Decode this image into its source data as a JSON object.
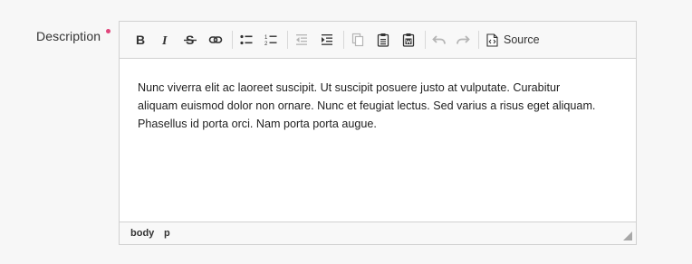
{
  "field": {
    "label": "Description"
  },
  "colors": {
    "required_mark": "#e0457b",
    "icon_active": "#333333",
    "icon_disabled": "#b5b5b5"
  },
  "toolbar": {
    "source_label": "Source",
    "buttons": [
      {
        "name": "bold",
        "icon": "bold-icon",
        "enabled": true
      },
      {
        "name": "italic",
        "icon": "italic-icon",
        "enabled": true
      },
      {
        "name": "strikethrough",
        "icon": "strikethrough-icon",
        "enabled": true
      },
      {
        "name": "link",
        "icon": "link-icon",
        "enabled": true
      },
      {
        "name": "bulleted-list",
        "icon": "bulleted-list-icon",
        "enabled": true
      },
      {
        "name": "numbered-list",
        "icon": "numbered-list-icon",
        "enabled": true
      },
      {
        "name": "outdent",
        "icon": "outdent-icon",
        "enabled": false
      },
      {
        "name": "indent",
        "icon": "indent-icon",
        "enabled": true
      },
      {
        "name": "copy",
        "icon": "copy-icon",
        "enabled": false
      },
      {
        "name": "paste",
        "icon": "paste-icon",
        "enabled": true
      },
      {
        "name": "paste-from-word",
        "icon": "paste-word-icon",
        "enabled": true
      },
      {
        "name": "undo",
        "icon": "undo-icon",
        "enabled": false
      },
      {
        "name": "redo",
        "icon": "redo-icon",
        "enabled": false
      },
      {
        "name": "source",
        "icon": "source-icon",
        "enabled": true
      }
    ]
  },
  "content": {
    "line1": "Nunc viverra elit ac laoreet suscipit. Ut suscipit posuere justo at vulputate. Curabitur",
    "line2": "aliquam euismod dolor non ornare. Nunc et feugiat lectus. Sed varius a risus eget aliquam.",
    "line3": "Phasellus id porta orci. Nam porta porta augue."
  },
  "statusbar": {
    "path": [
      "body",
      "p"
    ]
  }
}
